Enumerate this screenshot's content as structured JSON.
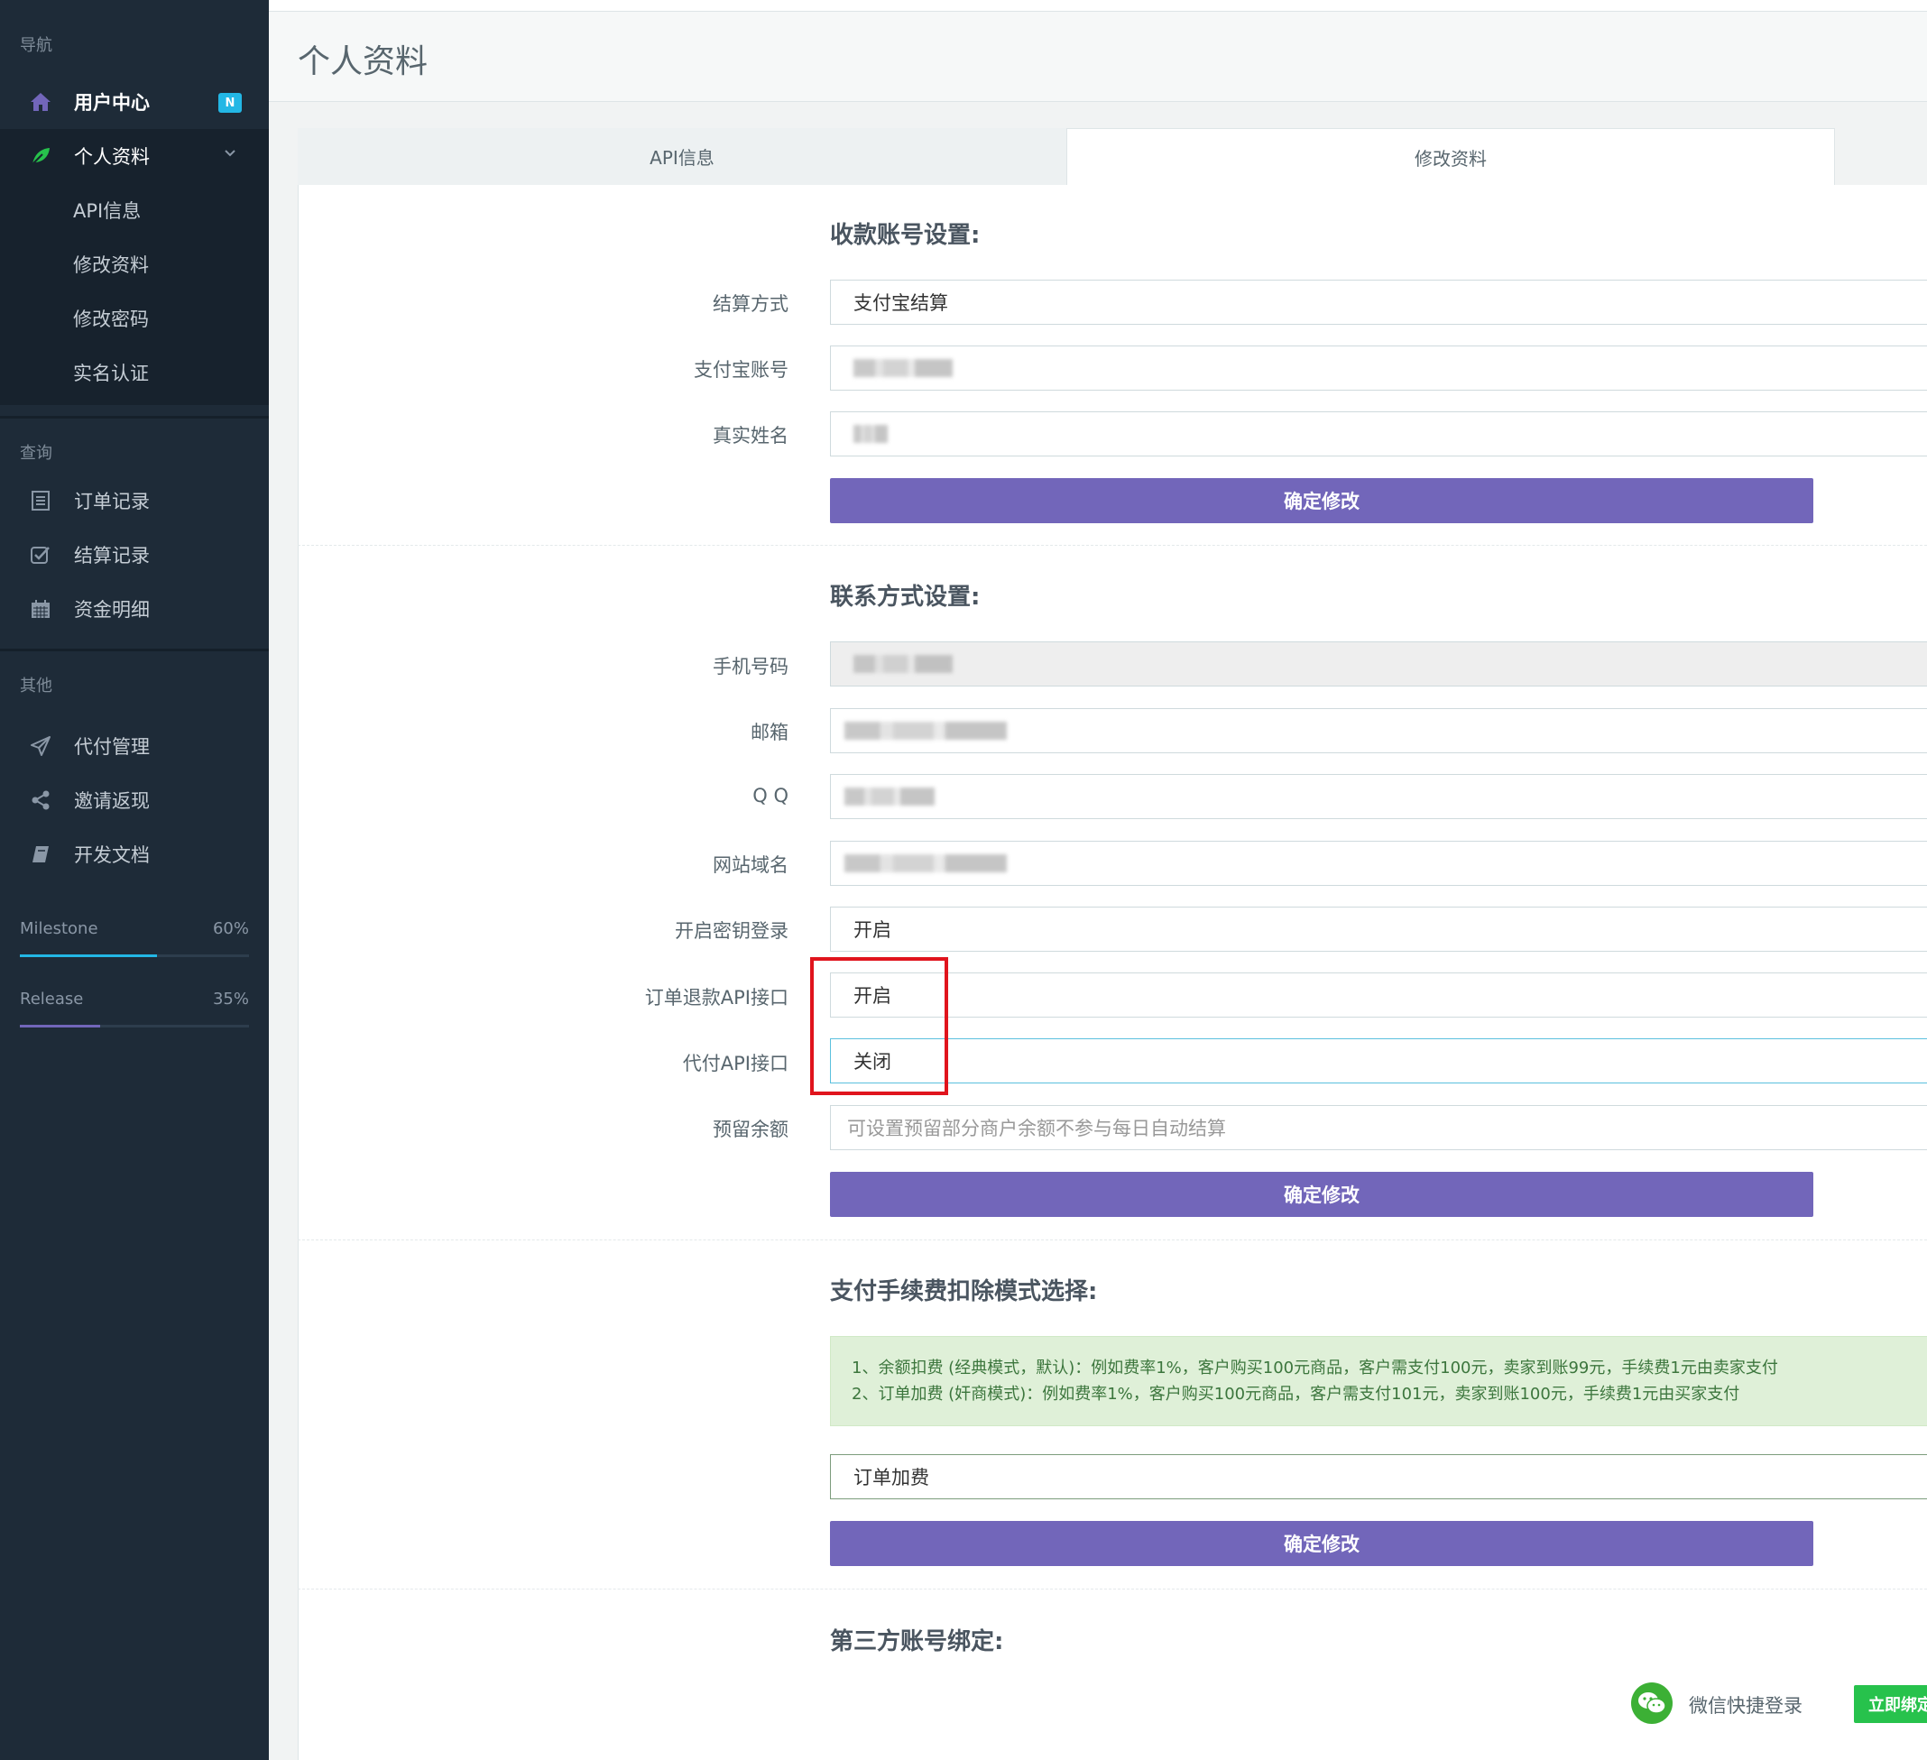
{
  "sidebar": {
    "heading_nav": "导航",
    "user_center": {
      "label": "用户中心",
      "badge": "N"
    },
    "profile": {
      "label": "个人资料"
    },
    "sub_items": [
      "API信息",
      "修改资料",
      "修改密码",
      "实名认证"
    ],
    "heading_query": "查询",
    "query_items": [
      "订单记录",
      "结算记录",
      "资金明细"
    ],
    "heading_other": "其他",
    "other_items": [
      "代付管理",
      "邀请返现",
      "开发文档"
    ],
    "progress": [
      {
        "name": "Milestone",
        "percent_label": "60%",
        "value": 60,
        "color": "#23b7e5"
      },
      {
        "name": "Release",
        "percent_label": "35%",
        "value": 35,
        "color": "#7266ba"
      }
    ]
  },
  "page": {
    "title": "个人资料"
  },
  "tabs": {
    "api_info": "API信息",
    "edit_profile": "修改资料"
  },
  "account_section": {
    "title": "收款账号设置:",
    "settle_method_label": "结算方式",
    "settle_method_value": "支付宝结算",
    "alipay_account_label": "支付宝账号",
    "real_name_label": "真实姓名",
    "confirm": "确定修改"
  },
  "contact_section": {
    "title": "联系方式设置:",
    "phone_label": "手机号码",
    "email_label": "邮箱",
    "qq_label": "Q Q",
    "domain_label": "网站域名",
    "key_login_label": "开启密钥登录",
    "key_login_value": "开启",
    "refund_api_label": "订单退款API接口",
    "refund_api_value": "开启",
    "payout_api_label": "代付API接口",
    "payout_api_value": "关闭",
    "reserve_label": "预留余额",
    "reserve_placeholder": "可设置预留部分商户余额不参与每日自动结算",
    "confirm": "确定修改"
  },
  "fee_section": {
    "title": "支付手续费扣除模式选择:",
    "line1": "1、余额扣费 (经典模式，默认)：例如费率1%，客户购买100元商品，客户需支付100元，卖家到账99元，手续费1元由卖家支付",
    "line2": "2、订单加费 (奸商模式)：例如费率1%，客户购买100元商品，客户需支付101元，卖家到账100元，手续费1元由买家支付",
    "mode_value": "订单加费",
    "confirm": "确定修改"
  },
  "third_party_section": {
    "title": "第三方账号绑定:",
    "wechat_label": "微信快捷登录",
    "bind_button": "立即绑定"
  },
  "icons": [
    "home-icon",
    "leaf-icon",
    "chevron-down-icon",
    "list-icon",
    "check-square-icon",
    "calendar-icon",
    "send-icon",
    "share-icon",
    "book-icon",
    "wechat-icon"
  ]
}
